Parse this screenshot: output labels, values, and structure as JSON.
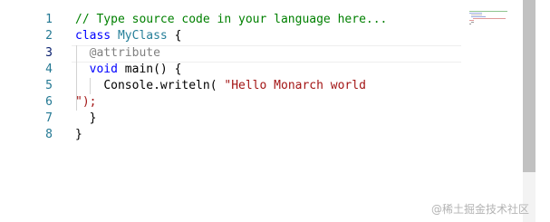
{
  "editor": {
    "line_numbers": [
      "1",
      "2",
      "3",
      "4",
      "5",
      "6",
      "7",
      "8"
    ],
    "lines": [
      [
        {
          "t": "// Type source code in your language here...",
          "c": "comment"
        }
      ],
      [
        {
          "t": "class",
          "c": "keyword"
        },
        {
          "t": " ",
          "c": "punct"
        },
        {
          "t": "MyClass",
          "c": "type"
        },
        {
          "t": " {",
          "c": "punct"
        }
      ],
      [
        {
          "t": "  ",
          "c": "punct"
        },
        {
          "t": "@attribute",
          "c": "annotation"
        }
      ],
      [
        {
          "t": "  ",
          "c": "punct"
        },
        {
          "t": "void",
          "c": "keyword"
        },
        {
          "t": " main() {",
          "c": "punct"
        }
      ],
      [
        {
          "t": "    ",
          "c": "punct"
        },
        {
          "t": "Console.writeln(",
          "c": "ident"
        },
        {
          "t": " ",
          "c": "punct"
        },
        {
          "t": "\"Hello Monarch world",
          "c": "string"
        }
      ],
      [
        {
          "t": "\");",
          "c": "string"
        }
      ],
      [
        {
          "t": "  }",
          "c": "punct"
        }
      ],
      [
        {
          "t": "}",
          "c": "punct"
        }
      ]
    ]
  },
  "colors": {
    "comment": "#008000",
    "keyword": "#0000ff",
    "type": "#267f99",
    "annotation": "#808080",
    "string": "#a31515",
    "line_number": "#237893"
  },
  "watermark": "@稀土掘金技术社区"
}
